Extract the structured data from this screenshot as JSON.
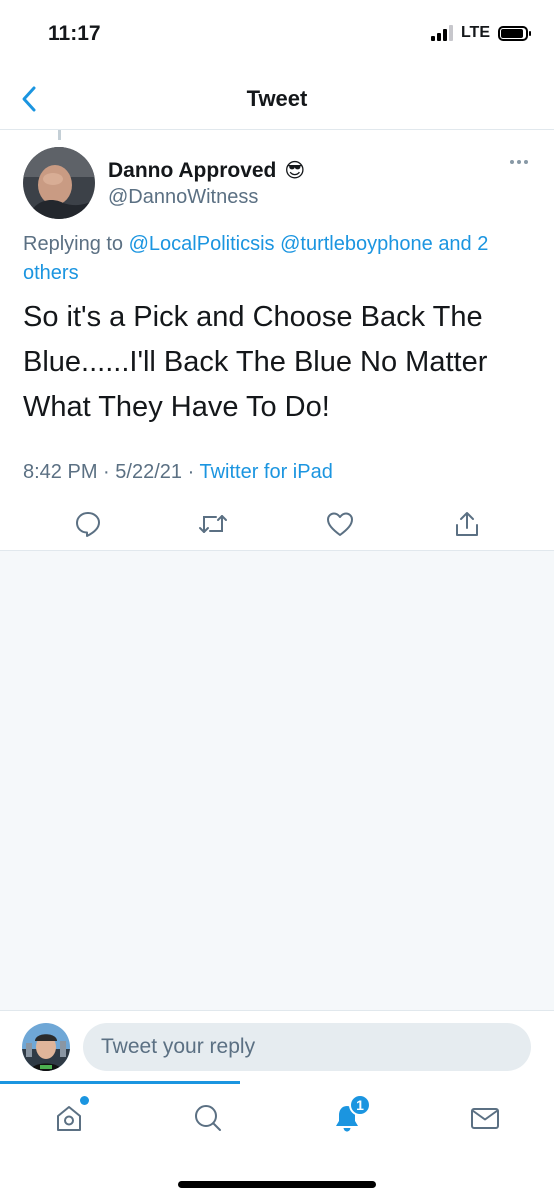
{
  "status_bar": {
    "time": "11:17",
    "network": "LTE",
    "battery_level": 0.9
  },
  "header": {
    "title": "Tweet"
  },
  "tweet": {
    "display_name": "Danno Approved",
    "emoji": "😎",
    "handle": "@DannoWitness",
    "replying_prefix": "Replying to",
    "replying_to": [
      "@LocalPoliticsis",
      "@turtleboyphone",
      "and 2 others"
    ],
    "text": "So it's a Pick and Choose Back The Blue......I'll Back The Blue No Matter What They Have To Do!",
    "time": "8:42 PM",
    "separator": "·",
    "date": "5/22/21",
    "source": "Twitter for iPad"
  },
  "reply_bar": {
    "placeholder": "Tweet your reply"
  },
  "tab_bar": {
    "notifications_badge": "1"
  },
  "colors": {
    "accent": "#1b95e0",
    "secondary_text": "#5b7083",
    "background_gray": "#f5f8fa",
    "divider": "#e1e8ed"
  },
  "icons": {
    "back": "chevron-left-icon",
    "more": "more-dots-icon",
    "reply": "reply-icon",
    "retweet": "retweet-icon",
    "like": "heart-icon",
    "share": "share-icon",
    "home": "home-icon",
    "search": "search-icon",
    "notifications": "bell-icon",
    "messages": "mail-icon"
  }
}
